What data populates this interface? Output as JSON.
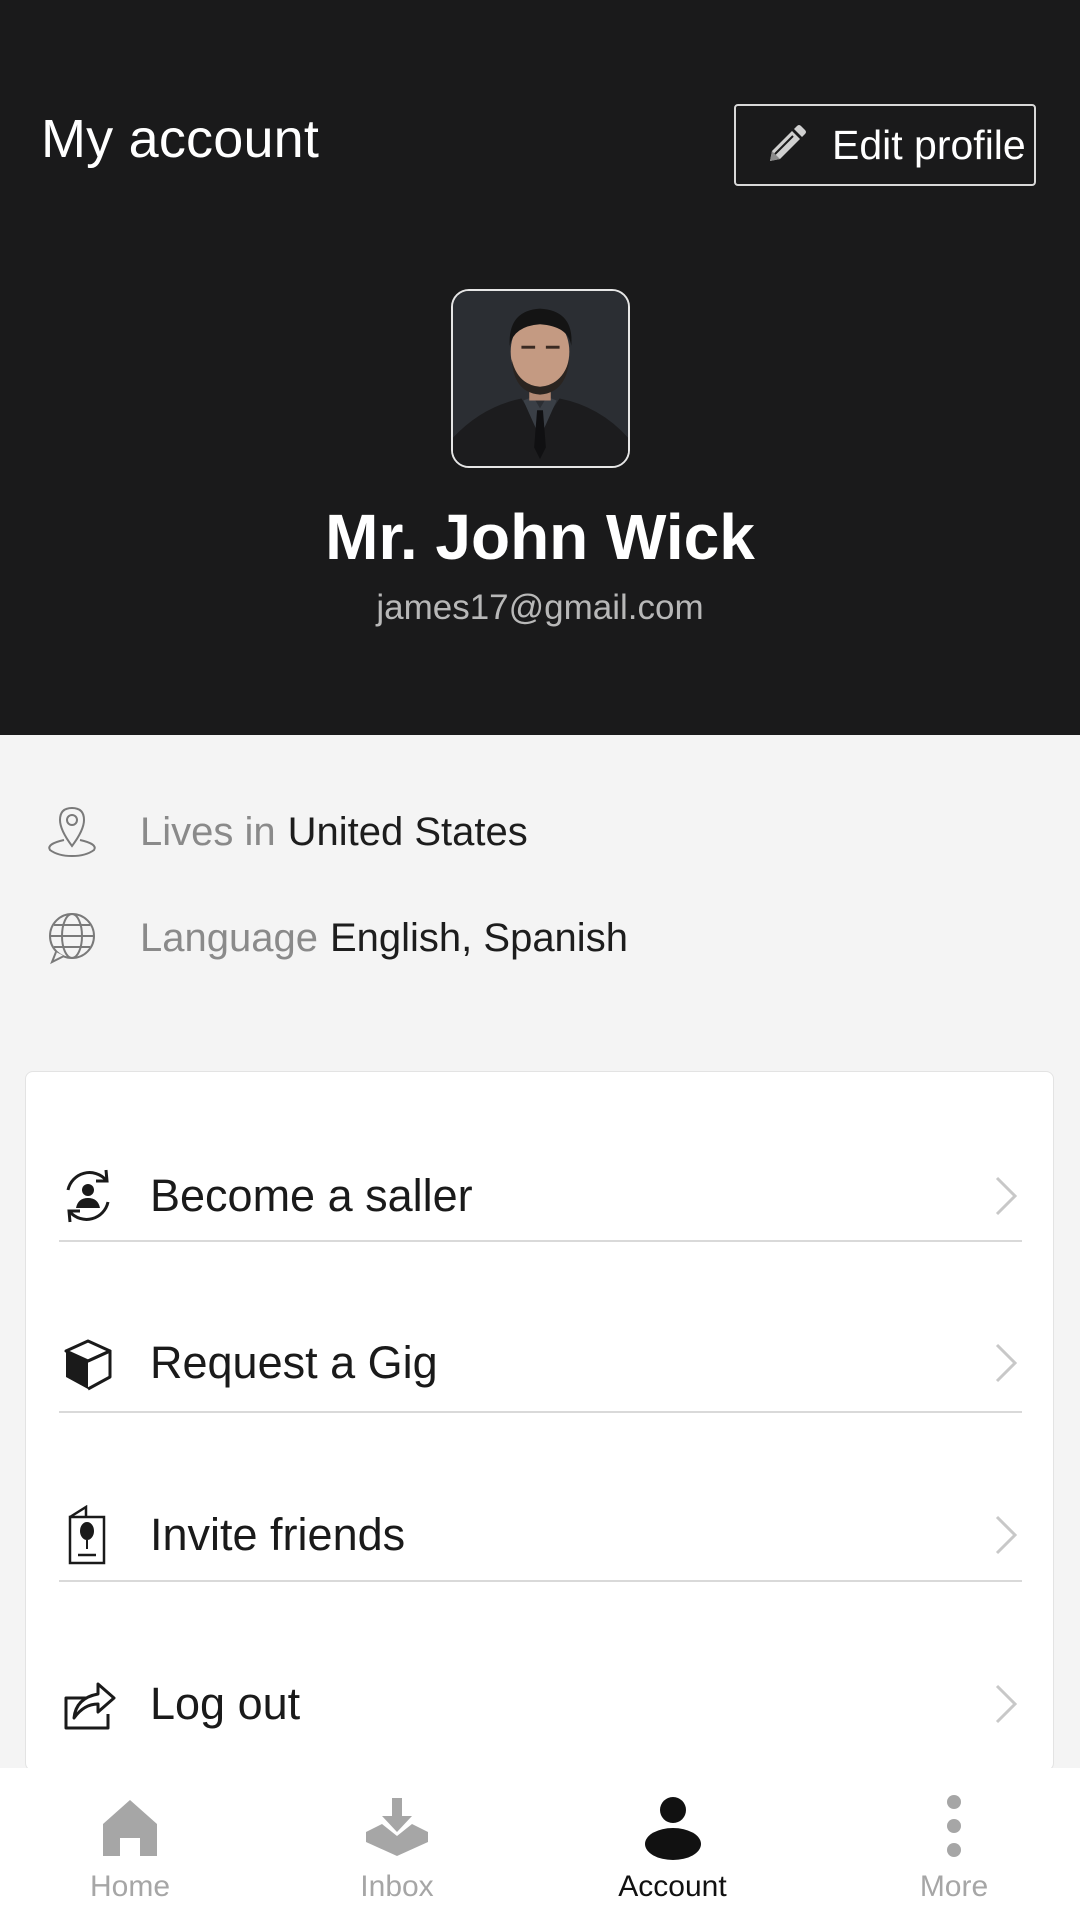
{
  "header": {
    "title": "My account",
    "edit_label": "Edit profile"
  },
  "profile": {
    "name": "Mr. John Wick",
    "email": "james17@gmail.com"
  },
  "info": {
    "location_label": "Lives in",
    "location_value": "United States",
    "language_label": "Language",
    "language_value": "English, Spanish"
  },
  "menu": {
    "items": [
      {
        "label": "Become a saller",
        "icon": "user-switch-icon"
      },
      {
        "label": "Request a Gig",
        "icon": "box-icon"
      },
      {
        "label": "Invite friends",
        "icon": "invite-card-icon"
      },
      {
        "label": "Log out",
        "icon": "logout-icon"
      }
    ]
  },
  "nav": {
    "items": [
      {
        "label": "Home",
        "icon": "home-icon",
        "active": false
      },
      {
        "label": "Inbox",
        "icon": "inbox-icon",
        "active": false
      },
      {
        "label": "Account",
        "icon": "account-icon",
        "active": true
      },
      {
        "label": "More",
        "icon": "more-icon",
        "active": false
      }
    ]
  },
  "colors": {
    "header_bg": "#1a1a1b",
    "page_bg": "#f4f4f4",
    "active": "#111111",
    "inactive": "#a6a6a6"
  }
}
